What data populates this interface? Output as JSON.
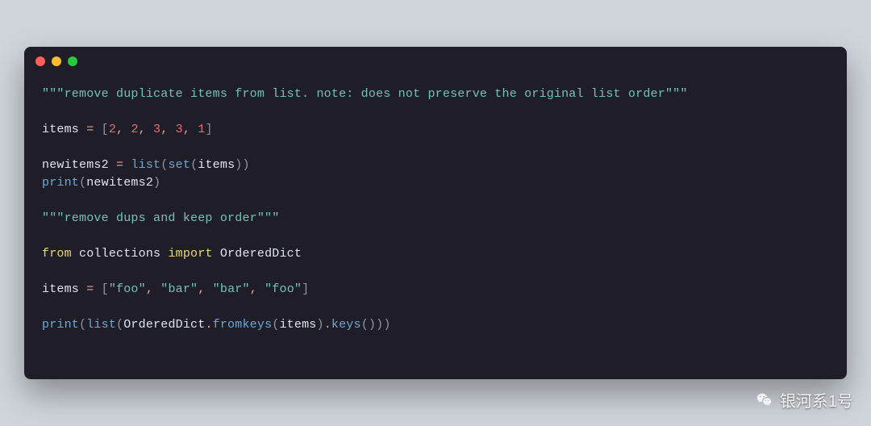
{
  "window": {
    "traffic_lights": [
      "red",
      "yellow",
      "green"
    ]
  },
  "code": {
    "doc1_open": "\"\"\"",
    "doc1_text": "remove duplicate items from list. note: does not preserve the original list order",
    "doc1_close": "\"\"\"",
    "assign1_lhs": "items",
    "assign1_eq": " = ",
    "assign1_lb": "[",
    "assign1_n1": "2",
    "assign1_c1": ", ",
    "assign1_n2": "2",
    "assign1_c2": ", ",
    "assign1_n3": "3",
    "assign1_c3": ", ",
    "assign1_n4": "3",
    "assign1_c4": ", ",
    "assign1_n5": "1",
    "assign1_rb": "]",
    "assign2_lhs": "newitems2",
    "assign2_eq": " = ",
    "call_list": "list",
    "lp": "(",
    "call_set": "set",
    "assign2_arg": "items",
    "rp": ")",
    "print": "print",
    "print_arg1": "newitems2",
    "doc2_open": "\"\"\"",
    "doc2_text": "remove dups and keep order",
    "doc2_close": "\"\"\"",
    "kw_from": "from",
    "sp": " ",
    "mod": "collections",
    "kw_import": "import",
    "cls": "OrderedDict",
    "assign3_lhs": "items",
    "assign3_eq": " = ",
    "assign3_lb": "[",
    "s_foo1": "\"foo\"",
    "s_c1": ", ",
    "s_bar1": "\"bar\"",
    "s_c2": ", ",
    "s_bar2": "\"bar\"",
    "s_c3": ", ",
    "s_foo2": "\"foo\"",
    "assign3_rb": "]",
    "dot": ".",
    "m_fromkeys": "fromkeys",
    "m_keys": "keys",
    "arg_items": "items"
  },
  "watermark": {
    "text": "银河系1号"
  }
}
